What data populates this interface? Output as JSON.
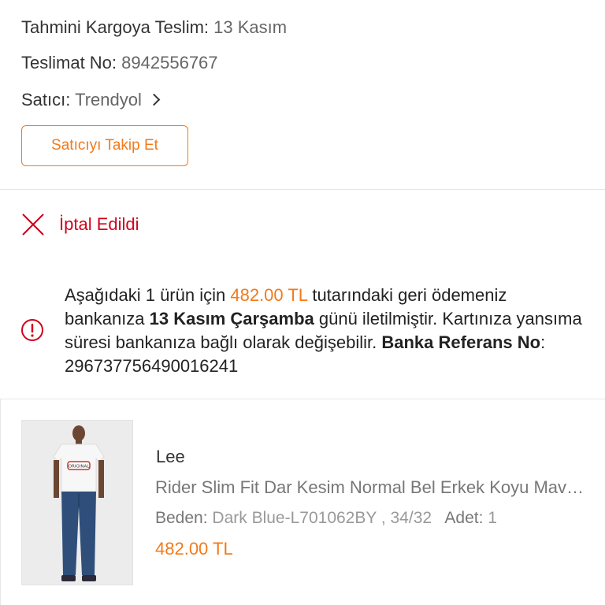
{
  "shipment": {
    "estimated_label": "Tahmini Kargoya Teslim:",
    "estimated_value": "13 Kasım",
    "delivery_no_label": "Teslimat No:",
    "delivery_no_value": "8942556767",
    "seller_label": "Satıcı:",
    "seller_value": "Trendyol"
  },
  "follow_button": {
    "label": "Satıcıyı Takip Et"
  },
  "status": {
    "label": "İptal Edildi"
  },
  "refund_info": {
    "t1": "Aşağıdaki 1 ürün için ",
    "amount": "482.00 TL",
    "t2": " tutarındaki geri ödemeniz bankanıza ",
    "date": "13 Kasım Çarşamba",
    "t3": " günü iletilmiştir. Kartınıza yansıma süresi bankanıza bağlı olarak değişebilir. ",
    "ref_label": "Banka Referans No",
    "t4": ": ",
    "ref_value": "296737756490016241"
  },
  "product": {
    "brand": "Lee",
    "name": "Rider Slim Fit Dar Kesim Normal Bel Erkek Koyu Mavi Jean",
    "size_label": "Beden:",
    "size_value": "Dark Blue-L701062BY , 34/32",
    "qty_label": "Adet:",
    "qty_value": "1",
    "price": "482.00 TL",
    "shirt_text": "ORIGINAL"
  },
  "colors": {
    "accent": "#f27a1a",
    "cancel": "#d0021b"
  }
}
